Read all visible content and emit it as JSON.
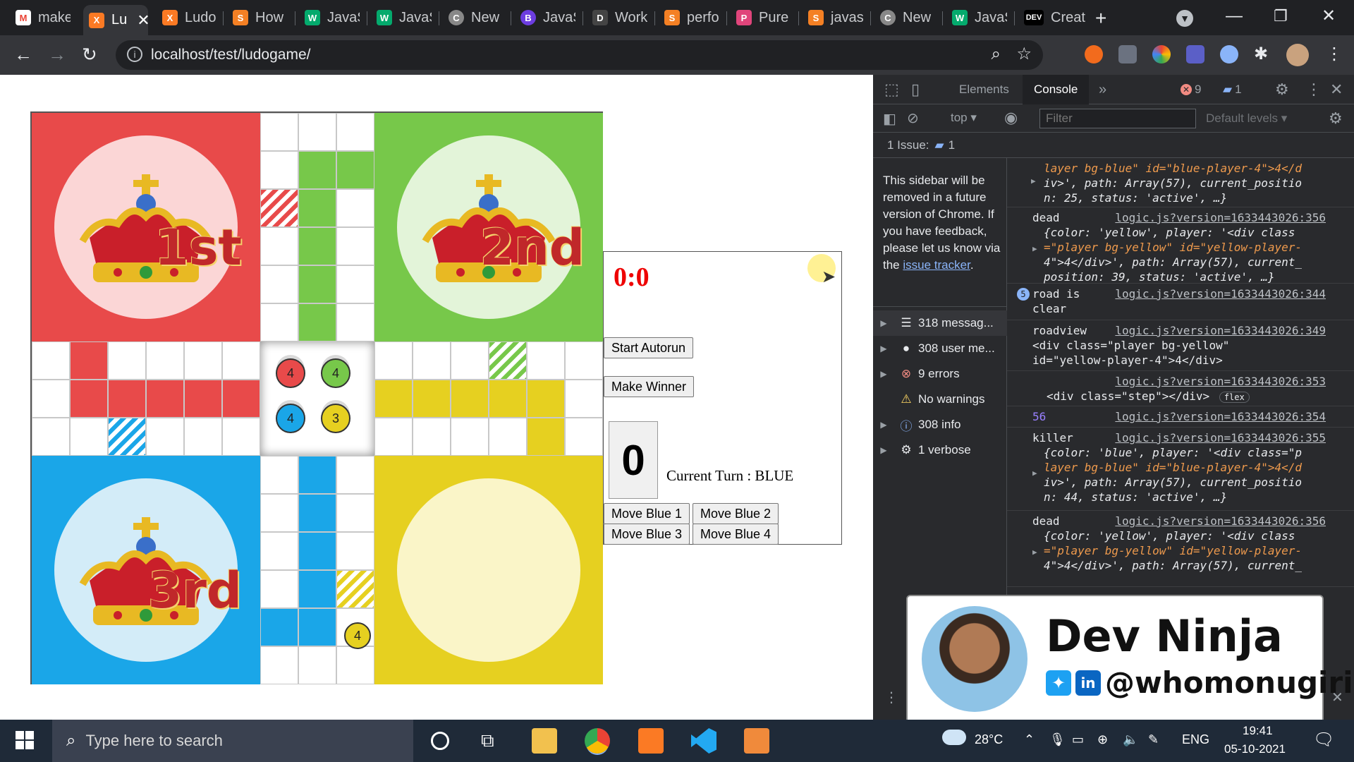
{
  "tabs": [
    {
      "label": "make",
      "icon": "M",
      "color": "#ea4335"
    },
    {
      "label": "Lu",
      "icon": "X",
      "color": "#fb7a24",
      "active": true
    },
    {
      "label": "Ludo",
      "icon": "X",
      "color": "#fb7a24"
    },
    {
      "label": "How",
      "icon": "S",
      "color": "#f48024"
    },
    {
      "label": "JavaS",
      "icon": "W",
      "color": "#04aa6d"
    },
    {
      "label": "JavaS",
      "icon": "W",
      "color": "#04aa6d"
    },
    {
      "label": "New",
      "icon": "C",
      "color": "#888888"
    },
    {
      "label": "JavaS",
      "icon": "B",
      "color": "#6c3de0"
    },
    {
      "label": "Work",
      "icon": "D",
      "color": "#444444"
    },
    {
      "label": "perfo",
      "icon": "S",
      "color": "#f48024"
    },
    {
      "label": "Pure",
      "icon": "P",
      "color": "#e0457b"
    },
    {
      "label": "javas",
      "icon": "S",
      "color": "#f48024"
    },
    {
      "label": "New",
      "icon": "C",
      "color": "#888888"
    },
    {
      "label": "JavaS",
      "icon": "W",
      "color": "#04aa6d"
    },
    {
      "label": "Creat",
      "icon": "DEV",
      "color": "#000000"
    }
  ],
  "new_tab_symbol": "+",
  "address": {
    "url": "localhost/test/ludogame/"
  },
  "game": {
    "score": "0:0",
    "dice_value": "0",
    "current_turn": "Current Turn : BLUE",
    "buttons": {
      "start_autorun": "Start Autorun",
      "make_winner": "Make Winner",
      "move_blue_1": "Move Blue 1",
      "move_blue_2": "Move Blue 2",
      "move_blue_3": "Move Blue 3",
      "move_blue_4": "Move Blue 4"
    },
    "ranks": {
      "red": "1st",
      "green": "2nd",
      "blue": "3rd"
    },
    "center_tokens": {
      "red": "4",
      "green": "4",
      "blue": "4",
      "yellow": "3"
    },
    "path_token_yellow": "4",
    "colors": {
      "red": "#e84a4a",
      "green": "#77c84a",
      "blue": "#1aa6e8",
      "yellow": "#e6d020"
    }
  },
  "devtools": {
    "tabs": {
      "elements": "Elements",
      "console": "Console"
    },
    "error_count": "9",
    "message_count": "1",
    "context": "top",
    "filter_placeholder": "Filter",
    "levels": "Default levels",
    "issues_label": "1 Issue:",
    "issues_count": "1",
    "sidebar_note": "This sidebar will be removed in a future version of Chrome. If you have feedback, please let us know via the",
    "sidebar_link": "issue tracker",
    "sidebar_items": [
      {
        "label": "318 messag...",
        "icon": "list-icon"
      },
      {
        "label": "308 user me...",
        "icon": "user-icon"
      },
      {
        "label": "9 errors",
        "icon": "error-icon"
      },
      {
        "label": "No warnings",
        "icon": "warning-icon"
      },
      {
        "label": "308 info",
        "icon": "info-icon"
      },
      {
        "label": "1 verbose",
        "icon": "gear-icon"
      }
    ],
    "console": {
      "m0_line1": "layer bg-blue\" id=\"blue-player-4\">4</d",
      "m0_line2": "iv>', path: Array(57), current_positio",
      "m0_line3": "n: 25, status: 'active', …}",
      "m1_label": "dead",
      "m1_src": "logic.js?version=1633443026:356",
      "m1_line1": "{color: 'yellow', player: '<div class",
      "m1_line2": "=\"player bg-yellow\" id=\"yellow-player-",
      "m1_line3": "4\">4</div>', path: Array(57), current_",
      "m1_line4": "position: 39, status: 'active', …}",
      "m2_count": "5",
      "m2_label": "road is",
      "m2_label2": "clear",
      "m2_src": "logic.js?version=1633443026:344",
      "m3_label": "roadview",
      "m3_src": "logic.js?version=1633443026:349",
      "m3_line1": "<div class=\"player bg-yellow\"",
      "m3_line2": "id=\"yellow-player-4\">4</div>",
      "m4_src": "logic.js?version=1633443026:353",
      "m4_line1": "<div class=\"step\"></div>",
      "m4_badge": "flex",
      "m5_label": "56",
      "m5_src": "logic.js?version=1633443026:354",
      "m6_label": "killer",
      "m6_src": "logic.js?version=1633443026:355",
      "m6_line1": "{color: 'blue', player: '<div class=\"p",
      "m6_line2": "layer bg-blue\" id=\"blue-player-4\">4</d",
      "m6_line3": "iv>', path: Array(57), current_positio",
      "m6_line4": "n: 44, status: 'active', …}",
      "m7_label": "dead",
      "m7_src": "logic.js?version=1633443026:356",
      "m7_line1": "{color: 'yellow', player: '<div class",
      "m7_line2": "=\"player bg-yellow\" id=\"yellow-player-",
      "m7_line3": "4\">4</div>', path: Array(57), current_"
    }
  },
  "overlay": {
    "name": "Dev Ninja",
    "handle": "@whomonugiri"
  },
  "taskbar": {
    "search_placeholder": "Type here to search",
    "temperature": "28°C",
    "language": "ENG",
    "time": "19:41",
    "date": "05-10-2021"
  }
}
